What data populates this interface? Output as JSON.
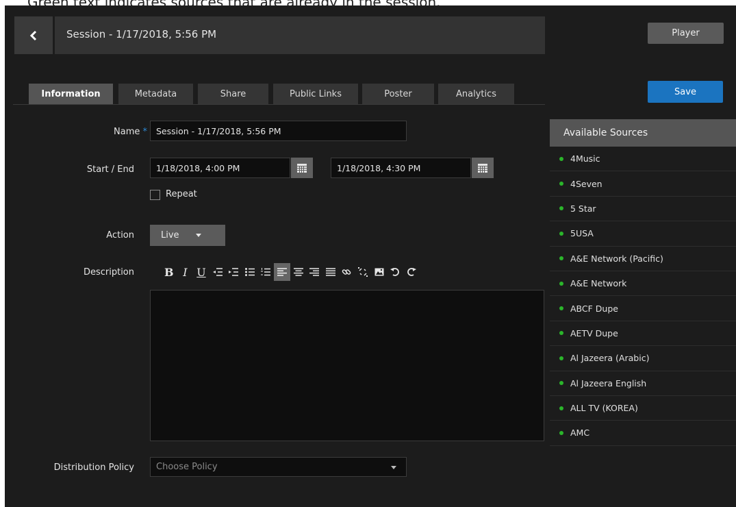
{
  "caption": "Green text indicates sources that are already in the session.",
  "header": {
    "title": "Session - 1/17/2018, 5:56 PM",
    "player_label": "Player"
  },
  "tabs": [
    {
      "label": "Information",
      "active": true
    },
    {
      "label": "Metadata"
    },
    {
      "label": "Share"
    },
    {
      "label": "Public Links"
    },
    {
      "label": "Poster"
    },
    {
      "label": "Analytics"
    }
  ],
  "save_label": "Save",
  "form": {
    "name_label": "Name",
    "name_required_mark": "*",
    "name_value": "Session - 1/17/2018, 5:56 PM",
    "start_end_label": "Start / End",
    "start_value": "1/18/2018, 4:00 PM",
    "end_value": "1/18/2018, 4:30 PM",
    "repeat_label": "Repeat",
    "repeat_checked": false,
    "action_label": "Action",
    "action_value": "Live",
    "description_label": "Description",
    "description_value": "",
    "distribution_label": "Distribution Policy",
    "distribution_placeholder": "Choose Policy"
  },
  "toolbar": [
    {
      "icon": "bold-icon",
      "glyph": "B"
    },
    {
      "icon": "italic-icon",
      "glyph": "I"
    },
    {
      "icon": "underline-icon",
      "glyph": "U"
    },
    {
      "icon": "outdent-icon"
    },
    {
      "icon": "indent-icon"
    },
    {
      "icon": "bullet-list-icon"
    },
    {
      "icon": "numbered-list-icon"
    },
    {
      "icon": "align-left-icon",
      "active": true
    },
    {
      "icon": "align-center-icon"
    },
    {
      "icon": "align-right-icon"
    },
    {
      "icon": "justify-icon"
    },
    {
      "icon": "link-icon"
    },
    {
      "icon": "unlink-icon"
    },
    {
      "icon": "image-icon"
    },
    {
      "icon": "undo-icon"
    },
    {
      "icon": "redo-icon"
    }
  ],
  "sources": {
    "title": "Available Sources",
    "status_color": "#2bb52b",
    "items": [
      "4Music",
      "4Seven",
      "5 Star",
      "5USA",
      "A&E Network (Pacific)",
      "A&E Network",
      "ABCF Dupe",
      "AETV Dupe",
      "Al Jazeera (Arabic)",
      "Al Jazeera English",
      "ALL TV (KOREA)",
      "AMC"
    ]
  },
  "colors": {
    "accent": "#1b74c0",
    "background": "#1c1c1c",
    "active_tab": "#555555"
  }
}
